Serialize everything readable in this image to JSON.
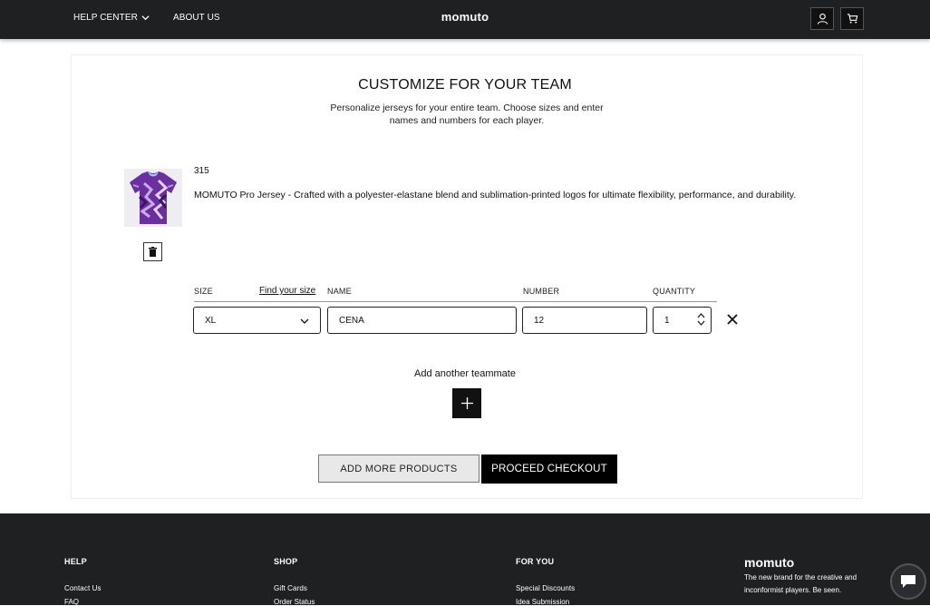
{
  "header": {
    "nav": [
      {
        "label": "HELP CENTER",
        "icon": "chevron-down-icon"
      },
      {
        "label": "ABOUT US"
      }
    ],
    "logo": "momuto",
    "icons": [
      "user-icon",
      "cart-icon"
    ]
  },
  "page": {
    "title": "CUSTOMIZE FOR YOUR TEAM",
    "subtitle": "Personalize jerseys for your entire team. Choose sizes and enter names and numbers for each player."
  },
  "product": {
    "code": "315",
    "description": "MOMUTO Pro Jersey - Crafted with a polyester-elastane blend and sublimation-printed logos for ultimate flexibility, performance, and durability."
  },
  "table": {
    "headers": {
      "size": "SIZE",
      "find_size": "Find your size",
      "name": "NAME",
      "number": "NUMBER",
      "quantity": "QUANTITY"
    },
    "rows": [
      {
        "size": "XL",
        "name": "CENA",
        "number": "12",
        "quantity": "1"
      }
    ]
  },
  "actions": {
    "add_teammate": "Add another teammate",
    "add_more_products": "ADD MORE PRODUCTS",
    "proceed_checkout": "PROCEED CHECKOUT"
  },
  "footer": {
    "columns": [
      {
        "heading": "HELP",
        "links": [
          "Contact Us",
          "FAQ"
        ]
      },
      {
        "heading": "SHOP",
        "links": [
          "Gift Cards",
          "Order Status"
        ]
      },
      {
        "heading": "FOR YOU",
        "links": [
          "Special Discounts",
          "Idea Submission"
        ]
      }
    ],
    "logo": "momuto",
    "tagline": "The new brand for the creative and inconformist players. Be seen."
  },
  "colors": {
    "header_bg": "#1f2022",
    "primary_button": "#000000",
    "jersey_purple": "#6b2fa0"
  }
}
